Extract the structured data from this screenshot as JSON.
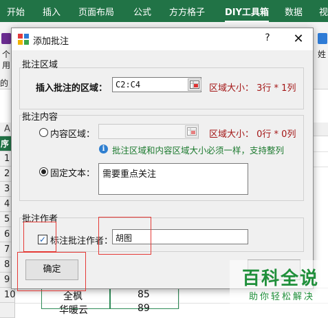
{
  "ribbon": {
    "tabs": [
      "开始",
      "插入",
      "页面布局",
      "公式",
      "方方格子",
      "DIY工具箱",
      "数据",
      "视"
    ],
    "left_snippets": [
      "个",
      "用",
      "的"
    ],
    "right_snippet": "姓",
    "colors": {
      "ribbon_green": "#217346",
      "accent_purple": "#6b2c91"
    }
  },
  "sheet": {
    "column_header": "A",
    "row_header_label": "序",
    "row_numbers": [
      "1",
      "2",
      "3",
      "4",
      "5",
      "6",
      "7",
      "8",
      "9",
      "10",
      ""
    ],
    "cell_texts": [
      "全枫",
      "85",
      "华暖云",
      "89"
    ]
  },
  "dialog": {
    "title": "添加批注",
    "help": "?",
    "close": "✕",
    "region": {
      "group_title": "批注区域",
      "label": "插入批注的区域：",
      "value": "C2:C4",
      "size_text": "区域大小： 3行 * 1列"
    },
    "content": {
      "group_title": "批注内容",
      "option_range": "内容区域：",
      "range_value": "",
      "range_size_text": "区域大小： 0行 * 0列",
      "info_text": "批注区域和内容区域大小必须一样，支持整列",
      "option_fixed": "固定文本：",
      "fixed_value": "需要重点关注"
    },
    "author": {
      "group_title": "批注作者",
      "checkbox_label": "标注批注作者：",
      "author_value": "胡图"
    },
    "ok_button": "确定"
  },
  "watermark": {
    "main": "百科全说",
    "sub": "助你轻松解决"
  }
}
